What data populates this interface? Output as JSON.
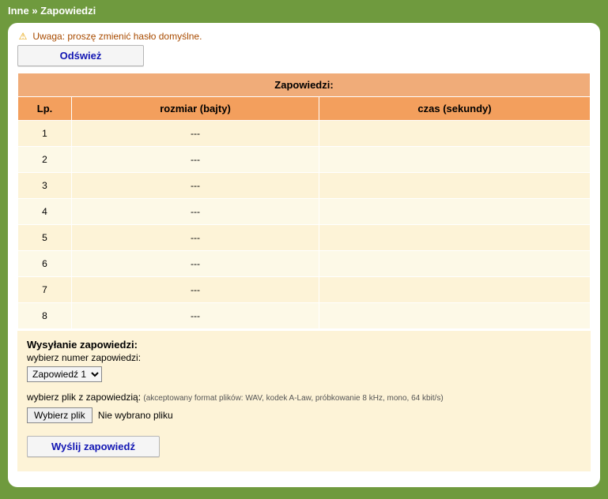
{
  "breadcrumb": "Inne » Zapowiedzi",
  "warning": {
    "icon": "⚠",
    "text": "Uwaga: proszę zmienić hasło domyślne."
  },
  "buttons": {
    "refresh": "Odśwież",
    "send": "Wyślij zapowiedź"
  },
  "table": {
    "title": "Zapowiedzi:",
    "columns": {
      "lp": "Lp.",
      "size": "rozmiar (bajty)",
      "time": "czas (sekundy)"
    },
    "rows": [
      {
        "lp": "1",
        "size": "---",
        "time": ""
      },
      {
        "lp": "2",
        "size": "---",
        "time": ""
      },
      {
        "lp": "3",
        "size": "---",
        "time": ""
      },
      {
        "lp": "4",
        "size": "---",
        "time": ""
      },
      {
        "lp": "5",
        "size": "---",
        "time": ""
      },
      {
        "lp": "6",
        "size": "---",
        "time": ""
      },
      {
        "lp": "7",
        "size": "---",
        "time": ""
      },
      {
        "lp": "8",
        "size": "---",
        "time": ""
      }
    ]
  },
  "upload": {
    "section_title": "Wysyłanie zapowiedzi:",
    "select_label": "wybierz numer zapowiedzi:",
    "select_value": "Zapowiedź 1",
    "file_label": "wybierz plik z zapowiedzią:",
    "file_hint": "(akceptowany format plików: WAV, kodek A-Law, próbkowanie 8 kHz, mono, 64 kbit/s)",
    "file_button": "Wybierz plik",
    "file_status": "Nie wybrano pliku"
  }
}
